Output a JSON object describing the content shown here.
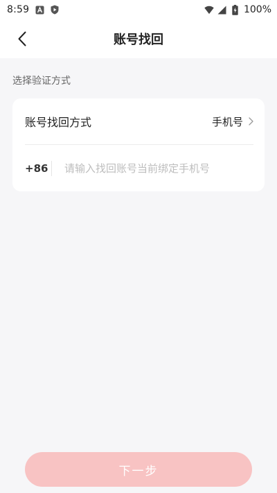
{
  "status_bar": {
    "time": "8:59",
    "battery_text": "100%",
    "icons": [
      "a-box-icon",
      "shield-icon",
      "wifi-icon",
      "signal-icon",
      "battery-icon"
    ]
  },
  "header": {
    "title": "账号找回",
    "back_icon": "chevron-left-icon"
  },
  "section": {
    "label": "选择验证方式"
  },
  "method_row": {
    "label": "账号找回方式",
    "value": "手机号",
    "chevron_icon": "chevron-right-icon"
  },
  "phone_row": {
    "country_code": "+86",
    "placeholder": "请输入找回账号当前绑定手机号",
    "value": ""
  },
  "next_button": {
    "label": "下一步",
    "color": "#f8c3c3"
  }
}
